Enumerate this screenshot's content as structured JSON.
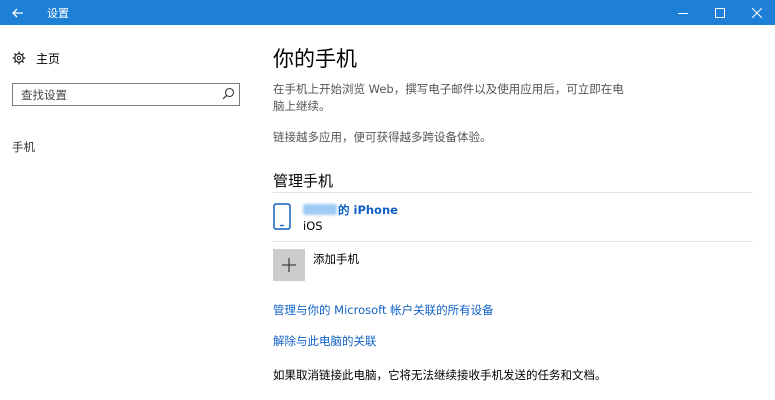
{
  "window": {
    "title": "设置"
  },
  "sidebar": {
    "home_label": "主页",
    "search_placeholder": "查找设置",
    "nav_phone": "手机"
  },
  "main": {
    "title": "你的手机",
    "desc1": "在手机上开始浏览 Web，撰写电子邮件以及使用应用后，可立即在电脑上继续。",
    "desc2": "链接越多应用，便可获得越多跨设备体验。",
    "section_title": "管理手机",
    "device": {
      "name_suffix": "的 iPhone",
      "os": "iOS"
    },
    "add_phone_label": "添加手机",
    "link_manage": "管理与你的 Microsoft 帐户关联的所有设备",
    "link_unlink": "解除与此电脑的关联",
    "note": "如果取消链接此电脑，它将无法继续接收手机发送的任务和文档。"
  },
  "colors": {
    "accent": "#1e7fd6",
    "link": "#1060c4"
  },
  "icons": {
    "back": "back-arrow-icon",
    "minimize": "minimize-icon",
    "maximize": "maximize-icon",
    "close": "close-icon",
    "home": "gear-icon",
    "search": "search-icon",
    "device": "phone-icon",
    "add": "plus-icon"
  }
}
